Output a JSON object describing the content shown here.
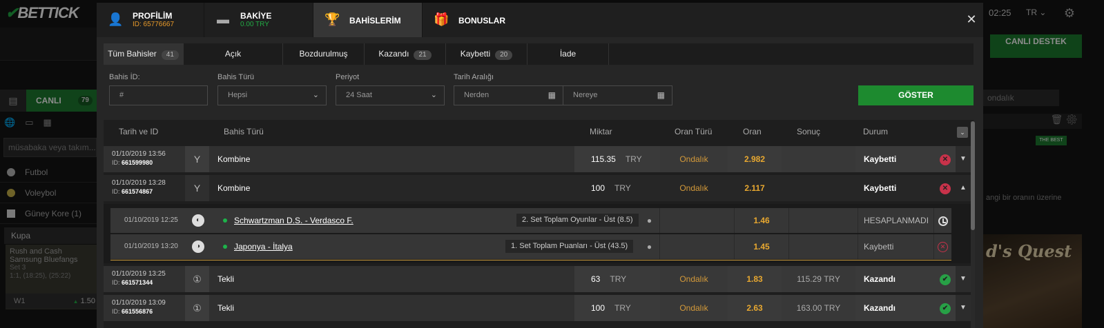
{
  "background": {
    "logo": "BETTICK",
    "live_label": "CANLI",
    "live_count": "79",
    "search_placeholder": "müsabaka veya takım...",
    "sports": [
      "Futbol",
      "Voleybol",
      "Güney Kore (1)"
    ],
    "cup_label": "Kupa",
    "match_card": {
      "teams": "Rush and Cash Samsung Bluefangs",
      "set": "Set 3",
      "score": "1:1, (18:25), (25:22)",
      "w1": "W1",
      "w1_odd": "1.50"
    },
    "time": "02:25",
    "lang": "TR",
    "support_label": "CANLI DESTEK",
    "odds_type": "ondalık",
    "best_badge": "THE BEST",
    "hint_text": "angi bir oranın üzerine",
    "banner_text": "d's Quest"
  },
  "tabs": [
    {
      "title": "PROFİLİM",
      "sub": "ID: 65776667",
      "icon": "user-icon",
      "color": "#e89a2a"
    },
    {
      "title": "BAKİYE",
      "sub": "0.00 TRY",
      "icon": "wallet-icon",
      "color": "#22aa44"
    },
    {
      "title": "BAHİSLERİM",
      "sub": "",
      "icon": "trophy-icon"
    },
    {
      "title": "BONUSLAR",
      "sub": "",
      "icon": "gift-icon"
    }
  ],
  "subtabs": [
    {
      "label": "Tüm Bahisler",
      "count": "41"
    },
    {
      "label": "Açık",
      "count": ""
    },
    {
      "label": "Bozdurulmuş",
      "count": ""
    },
    {
      "label": "Kazandı",
      "count": "21"
    },
    {
      "label": "Kaybetti",
      "count": "20"
    },
    {
      "label": "İade",
      "count": ""
    }
  ],
  "filters": {
    "bahis_id_label": "Bahis İD:",
    "bahis_id_placeholder": "#",
    "bahis_turu_label": "Bahis Türü",
    "bahis_turu_value": "Hepsi",
    "periyot_label": "Periyot",
    "periyot_value": "24 Saat",
    "tarih_label": "Tarih Aralığı",
    "from_placeholder": "Nerden",
    "to_placeholder": "Nereye",
    "show_button": "GÖSTER"
  },
  "table": {
    "headers": [
      "Tarih ve ID",
      "Bahis Türü",
      "Miktar",
      "Oran Türü",
      "Oran",
      "Sonuç",
      "Durum"
    ],
    "id_prefix": "ID:",
    "rows": [
      {
        "date": "01/10/2019 13:56",
        "id": "661599980",
        "type": "Kombine",
        "amount": "115.35",
        "currency": "TRY",
        "odds_type": "Ondalık",
        "odds": "2.982",
        "result": "",
        "status": "Kaybetti"
      },
      {
        "date": "01/10/2019 13:28",
        "id": "661574867",
        "type": "Kombine",
        "amount": "100",
        "currency": "TRY",
        "odds_type": "Ondalık",
        "odds": "2.117",
        "result": "",
        "status": "Kaybetti"
      },
      {
        "date": "01/10/2019 13:25",
        "id": "661571344",
        "type": "Tekli",
        "amount": "63",
        "currency": "TRY",
        "odds_type": "Ondalık",
        "odds": "1.83",
        "result": "115.29 TRY",
        "status": "Kazandı"
      },
      {
        "date": "01/10/2019 13:09",
        "id": "661556876",
        "type": "Tekli",
        "amount": "100",
        "currency": "TRY",
        "odds_type": "Ondalık",
        "odds": "2.63",
        "result": "163.00 TRY",
        "status": "Kazandı"
      }
    ],
    "selections": [
      {
        "date": "01/10/2019 12:25",
        "match": "Schwartzman D.S. - Verdasco F.",
        "market": "2. Set Toplam Oyunlar - Üst (8.5)",
        "odds": "1.46",
        "status": "HESAPLANMADI"
      },
      {
        "date": "01/10/2019 13:20",
        "match": "Japonya - İtalya",
        "market": "1. Set Toplam Puanları - Üst (43.5)",
        "odds": "1.45",
        "status": "Kaybetti"
      }
    ]
  }
}
